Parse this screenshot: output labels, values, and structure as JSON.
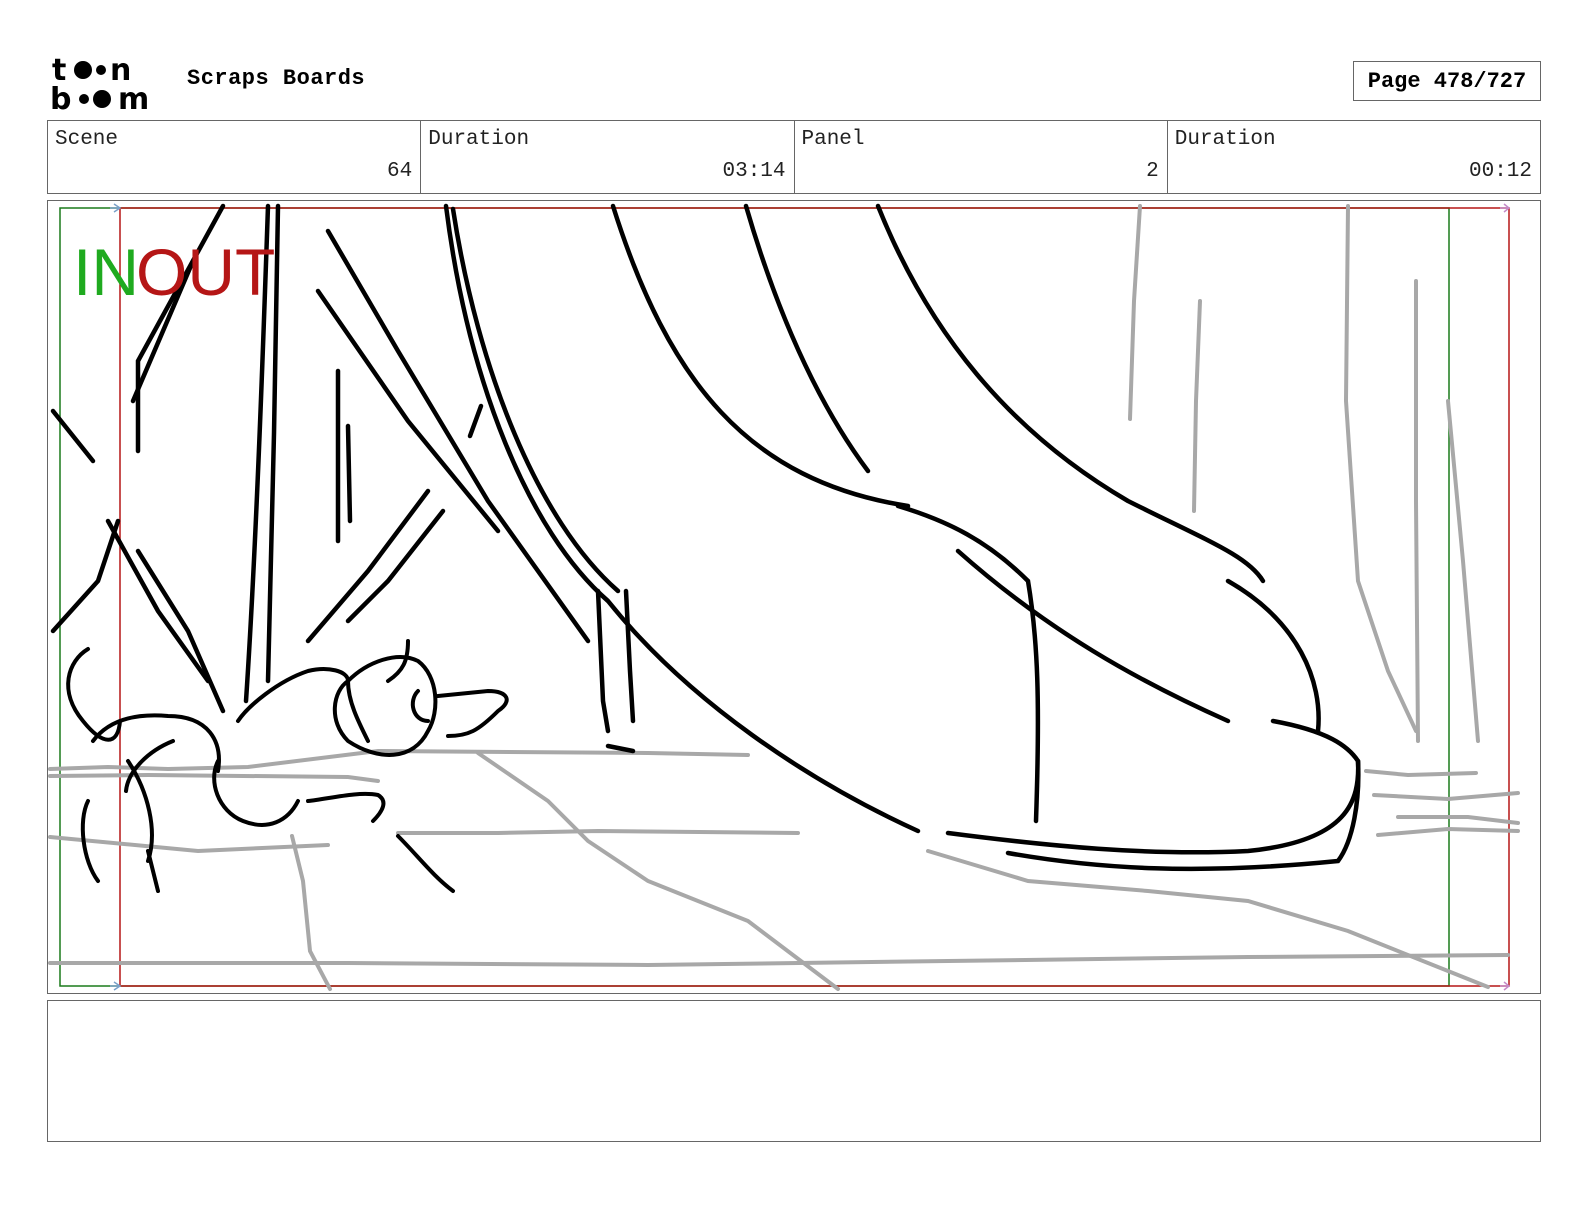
{
  "header": {
    "logo_text": "toonboom",
    "project_title": "Scraps Boards",
    "page_label": "Page 478/727"
  },
  "info": [
    {
      "label": "Scene",
      "value": "64"
    },
    {
      "label": "Duration",
      "value": "03:14"
    },
    {
      "label": "Panel",
      "value": "2"
    },
    {
      "label": "Duration",
      "value": "00:12"
    }
  ],
  "panel": {
    "in_label": "IN",
    "out_label": "OUT",
    "in_color": "#1faa1f",
    "out_color": "#b51616"
  },
  "notes": {
    "text": ""
  }
}
